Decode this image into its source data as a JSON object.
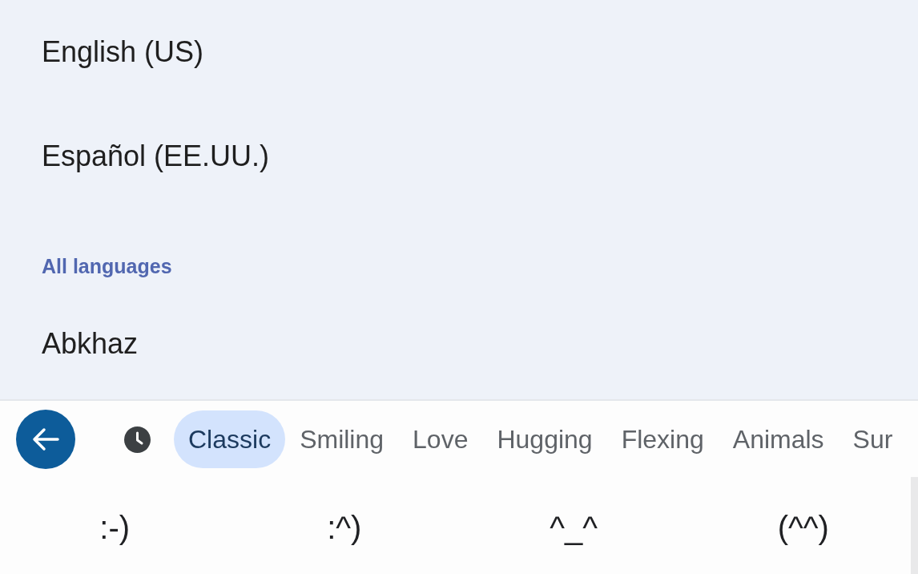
{
  "language_list": [
    {
      "kind": "language",
      "label": "English (US)"
    },
    {
      "kind": "language",
      "label": "Español (EE.UU.)"
    },
    {
      "kind": "header",
      "label": "All languages"
    },
    {
      "kind": "language",
      "label": "Abkhaz"
    }
  ],
  "emoji_keyboard": {
    "categories": [
      {
        "kind": "recent",
        "selected": false
      },
      {
        "kind": "text",
        "label": "Classic",
        "selected": true
      },
      {
        "kind": "text",
        "label": "Smiling",
        "selected": false
      },
      {
        "kind": "text",
        "label": "Love",
        "selected": false
      },
      {
        "kind": "text",
        "label": "Hugging",
        "selected": false
      },
      {
        "kind": "text",
        "label": "Flexing",
        "selected": false
      },
      {
        "kind": "text",
        "label": "Animals",
        "selected": false
      },
      {
        "kind": "text",
        "label": "Sur",
        "selected": false
      }
    ],
    "emoticons": [
      ":-)",
      ":^)",
      "^_^",
      "(^^)"
    ]
  }
}
